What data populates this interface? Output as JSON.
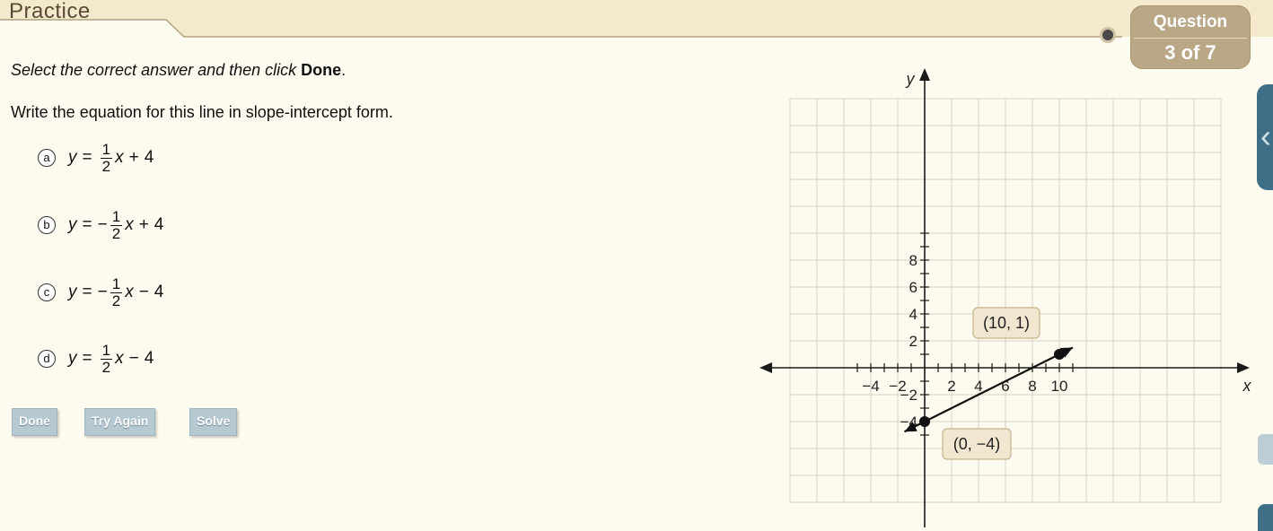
{
  "header": {
    "section_title": "Practice",
    "question_label": "Question",
    "question_count": "3 of 7"
  },
  "instruction": {
    "text": "Select the correct answer and then click",
    "bold": "Done",
    "period": "."
  },
  "prompt": "Write the equation for this line in slope-intercept form.",
  "choices": [
    {
      "letter": "a",
      "y": "y",
      "eq": "=",
      "sign": "",
      "num": "1",
      "den": "2",
      "x": "x",
      "op": "+",
      "const": "4"
    },
    {
      "letter": "b",
      "y": "y",
      "eq": "=",
      "sign": "−",
      "num": "1",
      "den": "2",
      "x": "x",
      "op": "+",
      "const": "4"
    },
    {
      "letter": "c",
      "y": "y",
      "eq": "=",
      "sign": "−",
      "num": "1",
      "den": "2",
      "x": "x",
      "op": "−",
      "const": "4"
    },
    {
      "letter": "d",
      "y": "y",
      "eq": "=",
      "sign": "",
      "num": "1",
      "den": "2",
      "x": "x",
      "op": "−",
      "const": "4"
    }
  ],
  "buttons": {
    "done": "Done",
    "try_again": "Try Again",
    "solve": "Solve"
  },
  "side": {
    "chevron_icon": "chevron-left-icon",
    "speaker_icon": "speaker-icon"
  },
  "chart_data": {
    "type": "line",
    "title": "",
    "xlabel": "x",
    "ylabel": "y",
    "xlim": [
      -5,
      11
    ],
    "ylim": [
      -5,
      10
    ],
    "grid": true,
    "x_tick_labels": [
      "−4",
      "−2",
      "2",
      "4",
      "6",
      "8",
      "10"
    ],
    "x_tick_values": [
      -4,
      -2,
      2,
      4,
      6,
      8,
      10
    ],
    "y_tick_labels": [
      "−4",
      "−2",
      "2",
      "4",
      "6",
      "8"
    ],
    "y_tick_values": [
      -4,
      -2,
      2,
      4,
      6,
      8
    ],
    "series": [
      {
        "x": [
          0,
          10
        ],
        "y": [
          -4,
          1
        ]
      }
    ],
    "points": [
      {
        "x": 0,
        "y": -4,
        "label": "(0, −4)"
      },
      {
        "x": 10,
        "y": 1,
        "label": "(10, 1)"
      }
    ],
    "colors": {
      "grid": "#dcd3c2",
      "axis": "#1a1a1a",
      "callout_bg": "#f1e6cf",
      "callout_border": "#c7b48f"
    }
  }
}
